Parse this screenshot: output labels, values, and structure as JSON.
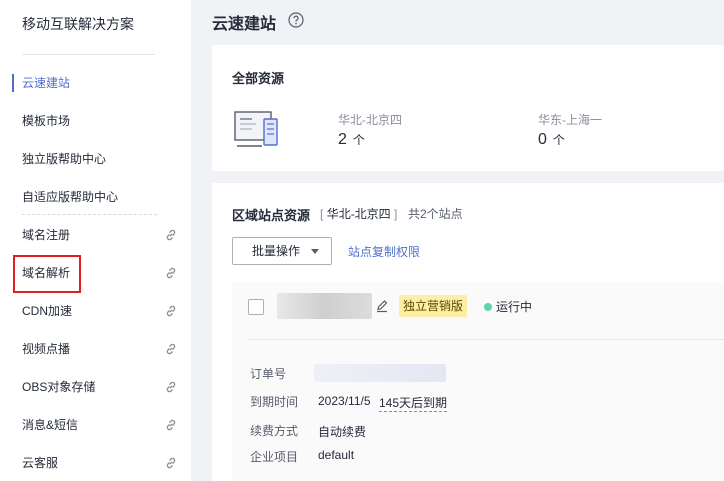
{
  "sidebar": {
    "title": "移动互联解决方案",
    "items": [
      {
        "label": "云速建站",
        "active": true
      },
      {
        "label": "模板市场"
      },
      {
        "label": "独立版帮助中心"
      },
      {
        "label": "自适应版帮助中心"
      },
      {
        "label": "域名注册",
        "external": true
      },
      {
        "label": "域名解析",
        "external": true,
        "highlighted": true
      },
      {
        "label": "CDN加速",
        "external": true
      },
      {
        "label": "视频点播",
        "external": true
      },
      {
        "label": "OBS对象存储",
        "external": true
      },
      {
        "label": "消息&短信",
        "external": true
      },
      {
        "label": "云客服",
        "external": true
      }
    ]
  },
  "header": {
    "title": "云速建站",
    "help_icon": "question-circle-icon"
  },
  "all_resources": {
    "title": "全部资源",
    "icon": "server-icon",
    "regions": [
      {
        "name": "华北-北京四",
        "count": "2",
        "unit": "个"
      },
      {
        "name": "华东-上海一",
        "count": "0",
        "unit": "个"
      }
    ]
  },
  "regional": {
    "title": "区域站点资源",
    "bracket_open": "[",
    "region": "华北-北京四",
    "bracket_close": "]",
    "site_count": "共2个站点",
    "batch_button": "批量操作",
    "copy_link": "站点复制权限",
    "site": {
      "badge": "独立营销版",
      "status": "运行中",
      "status_color": "#5dd4a6",
      "details": [
        {
          "label": "订单号",
          "value": ""
        },
        {
          "label": "到期时间",
          "value": "2023/11/5",
          "extra": "145天后到期"
        },
        {
          "label": "续费方式",
          "value": "自动续费"
        },
        {
          "label": "企业项目",
          "value": "default"
        }
      ]
    }
  },
  "colors": {
    "accent": "#526ecc",
    "highlight_border": "#e02020",
    "badge_bg": "#fdeda5"
  }
}
